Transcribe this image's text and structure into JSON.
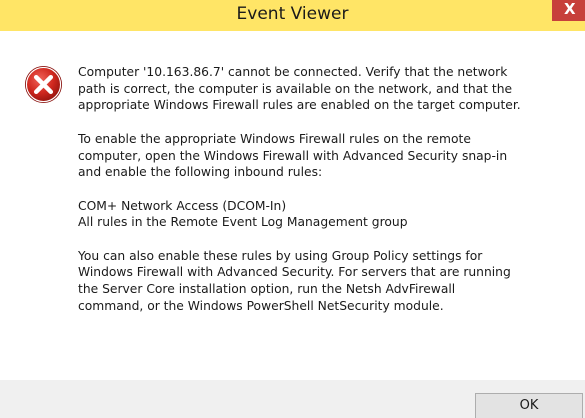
{
  "window": {
    "title": "Event Viewer",
    "close_glyph": "X",
    "titlebar_color": "#ffe566",
    "close_color": "#c7403b"
  },
  "dialog": {
    "icon": "error-icon",
    "paragraphs": [
      "Computer '10.163.86.7' cannot be connected. Verify that the network\npath is correct, the computer is available on the network, and that the\nappropriate Windows Firewall rules are enabled on the target computer.",
      "To enable the appropriate Windows Firewall rules on the remote\ncomputer, open the Windows Firewall with Advanced Security snap-in\nand enable the following inbound rules:",
      "COM+ Network Access (DCOM-In)\nAll rules in the Remote Event Log Management group",
      "You can also enable these rules by using Group Policy settings for\nWindows Firewall with Advanced Security. For servers that are running\nthe Server Core installation option, run the Netsh AdvFirewall\ncommand, or the Windows PowerShell NetSecurity module."
    ]
  },
  "buttons": {
    "ok_label": "OK"
  }
}
